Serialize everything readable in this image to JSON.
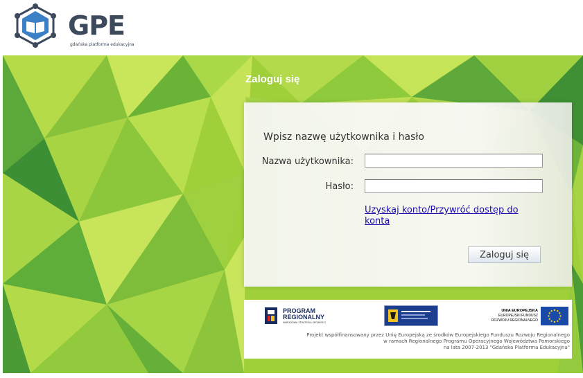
{
  "header": {
    "logo_name": "GPE",
    "logo_subtitle": "gdańska platforma edukacyjna"
  },
  "login": {
    "title": "Zaloguj się",
    "heading": "Wpisz nazwę użytkownika i hasło",
    "username_label": "Nazwa użytkownika:",
    "username_value": "",
    "password_label": "Hasło:",
    "password_value": "",
    "recover_link": "Uzyskaj konto/Przywróć dostęp do konta",
    "submit_label": "Zaloguj się"
  },
  "footer": {
    "program_title_line1": "PROGRAM",
    "program_title_line2": "REGIONALNY",
    "program_subtitle": "NARODOWA STRATEGIA SPÓJNOŚCI",
    "ue_title": "UNIA EUROPEJSKA",
    "ue_sub1": "EUROPEJSKI FUNDUSZ",
    "ue_sub2": "ROZWOJU REGIONALNEGO",
    "caption_line1": "Projekt współfinansowany przez Unię Europejską ze środków Europejskiego Funduszu Rozwoju Regionalnego",
    "caption_line2": "w ramach Regionalnego Programu Operacyjnego Województwa Pomorskiego",
    "caption_line3": "na lata 2007-2013 \"Gdańska Platforma Edukacyjna\""
  },
  "colors": {
    "background_green_light": "#b7dc3a",
    "background_green_dark": "#3f9a37",
    "link": "#1a0dab",
    "logo_text": "#3d4a5c",
    "eu_blue": "#1b49a8"
  }
}
